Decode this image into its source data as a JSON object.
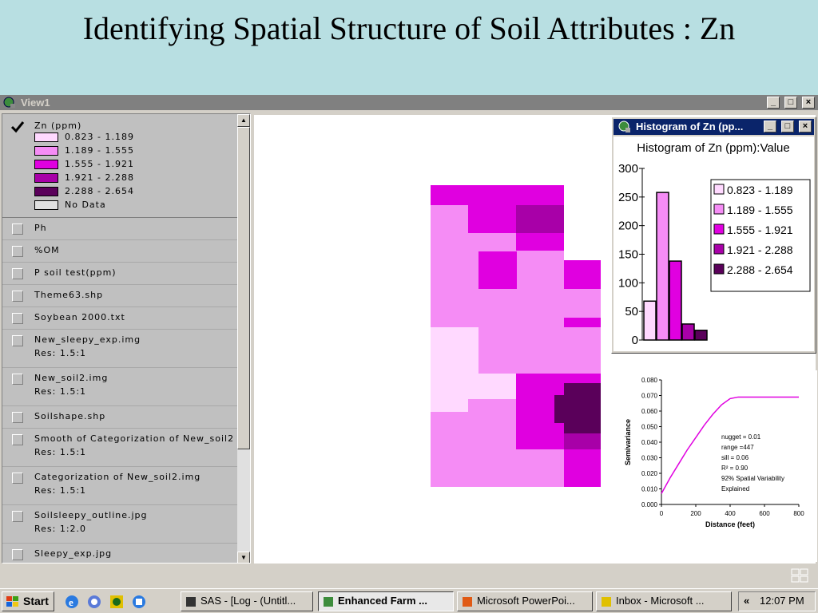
{
  "slide": {
    "title": "Identifying Spatial Structure of Soil Attributes : Zn"
  },
  "window": {
    "title": "View1",
    "min_glyph": "_",
    "max_glyph": "□",
    "close_glyph": "×"
  },
  "toc": {
    "active_theme": {
      "name": "Zn (ppm)",
      "legend": [
        {
          "label": "0.823 - 1.189",
          "color": "#ffd9ff"
        },
        {
          "label": "1.189 - 1.555",
          "color": "#f58cf5"
        },
        {
          "label": "1.555 - 1.921",
          "color": "#e000e0"
        },
        {
          "label": "1.921 - 2.288",
          "color": "#a800a8"
        },
        {
          "label": "2.288 - 2.654",
          "color": "#5a005a"
        },
        {
          "label": "No Data",
          "color": "#e0e0e0"
        }
      ]
    },
    "themes": [
      {
        "name": "Ph",
        "res": ""
      },
      {
        "name": "%OM",
        "res": ""
      },
      {
        "name": "P soil test(ppm)",
        "res": ""
      },
      {
        "name": "Theme63.shp",
        "res": ""
      },
      {
        "name": "Soybean 2000.txt",
        "res": ""
      },
      {
        "name": "New_sleepy_exp.img",
        "res": "Res: 1.5:1"
      },
      {
        "name": "New_soil2.img",
        "res": "Res: 1.5:1"
      },
      {
        "name": "Soilshape.shp",
        "res": ""
      },
      {
        "name": "Smooth of Categorization of New_soil2",
        "res": "Res: 1.5:1"
      },
      {
        "name": "Categorization of New_soil2.img",
        "res": "Res: 1.5:1"
      },
      {
        "name": "Soilsleepy_outline.jpg",
        "res": "Res: 1:2.0"
      },
      {
        "name": "Sleepy_exp.jpg",
        "res": ""
      }
    ]
  },
  "histogram": {
    "window_title": "Histogram of Zn (pp...",
    "chart_title": "Histogram of Zn (ppm):Value",
    "y_ticks": [
      "300",
      "250",
      "200",
      "150",
      "100",
      "50",
      "0"
    ],
    "bars": [
      {
        "value": 68,
        "color": "#ffd9ff"
      },
      {
        "value": 258,
        "color": "#f58cf5"
      },
      {
        "value": 138,
        "color": "#e000e0"
      },
      {
        "value": 28,
        "color": "#a800a8"
      },
      {
        "value": 17,
        "color": "#5a005a"
      }
    ],
    "legend": [
      "0.823 - 1.189",
      "1.189 - 1.555",
      "1.555 - 1.921",
      "1.921 - 2.288",
      "2.288 - 2.654"
    ]
  },
  "semivariogram": {
    "ylabel": "Semivariance",
    "xlabel": "Distance (feet)",
    "y_ticks": [
      "0.080",
      "0.070",
      "0.060",
      "0.050",
      "0.040",
      "0.030",
      "0.020",
      "0.010",
      "0.000"
    ],
    "x_ticks": [
      "0",
      "200",
      "400",
      "600",
      "800"
    ],
    "annotations": [
      "nugget = 0.01",
      "range =447",
      "sill = 0.06",
      "R² = 0.90",
      "92% Spatial Variability",
      "Explained"
    ]
  },
  "taskbar": {
    "start_label": "Start",
    "tasks": [
      "SAS - [Log - (Untitl...",
      "Enhanced Farm ...",
      "Microsoft PowerPoi...",
      "Inbox - Microsoft ..."
    ],
    "tray_arrows": "«",
    "clock": "12:07 PM"
  },
  "chart_data": [
    {
      "type": "bar",
      "title": "Histogram of Zn (ppm):Value",
      "categories": [
        "0.823 - 1.189",
        "1.189 - 1.555",
        "1.555 - 1.921",
        "1.921 - 2.288",
        "2.288 - 2.654"
      ],
      "values": [
        68,
        258,
        138,
        28,
        17
      ],
      "ylim": [
        0,
        300
      ],
      "legend_position": "right"
    },
    {
      "type": "line",
      "title": "",
      "xlabel": "Distance (feet)",
      "ylabel": "Semivariance",
      "xlim": [
        0,
        800
      ],
      "ylim": [
        0,
        0.08
      ],
      "series": [
        {
          "x": [
            0,
            50,
            100,
            150,
            200,
            250,
            300,
            350,
            400,
            447,
            500,
            600,
            700,
            800
          ],
          "y": [
            0.007,
            0.017,
            0.026,
            0.035,
            0.043,
            0.051,
            0.058,
            0.064,
            0.068,
            0.069,
            0.069,
            0.069,
            0.069,
            0.069
          ]
        }
      ]
    }
  ]
}
